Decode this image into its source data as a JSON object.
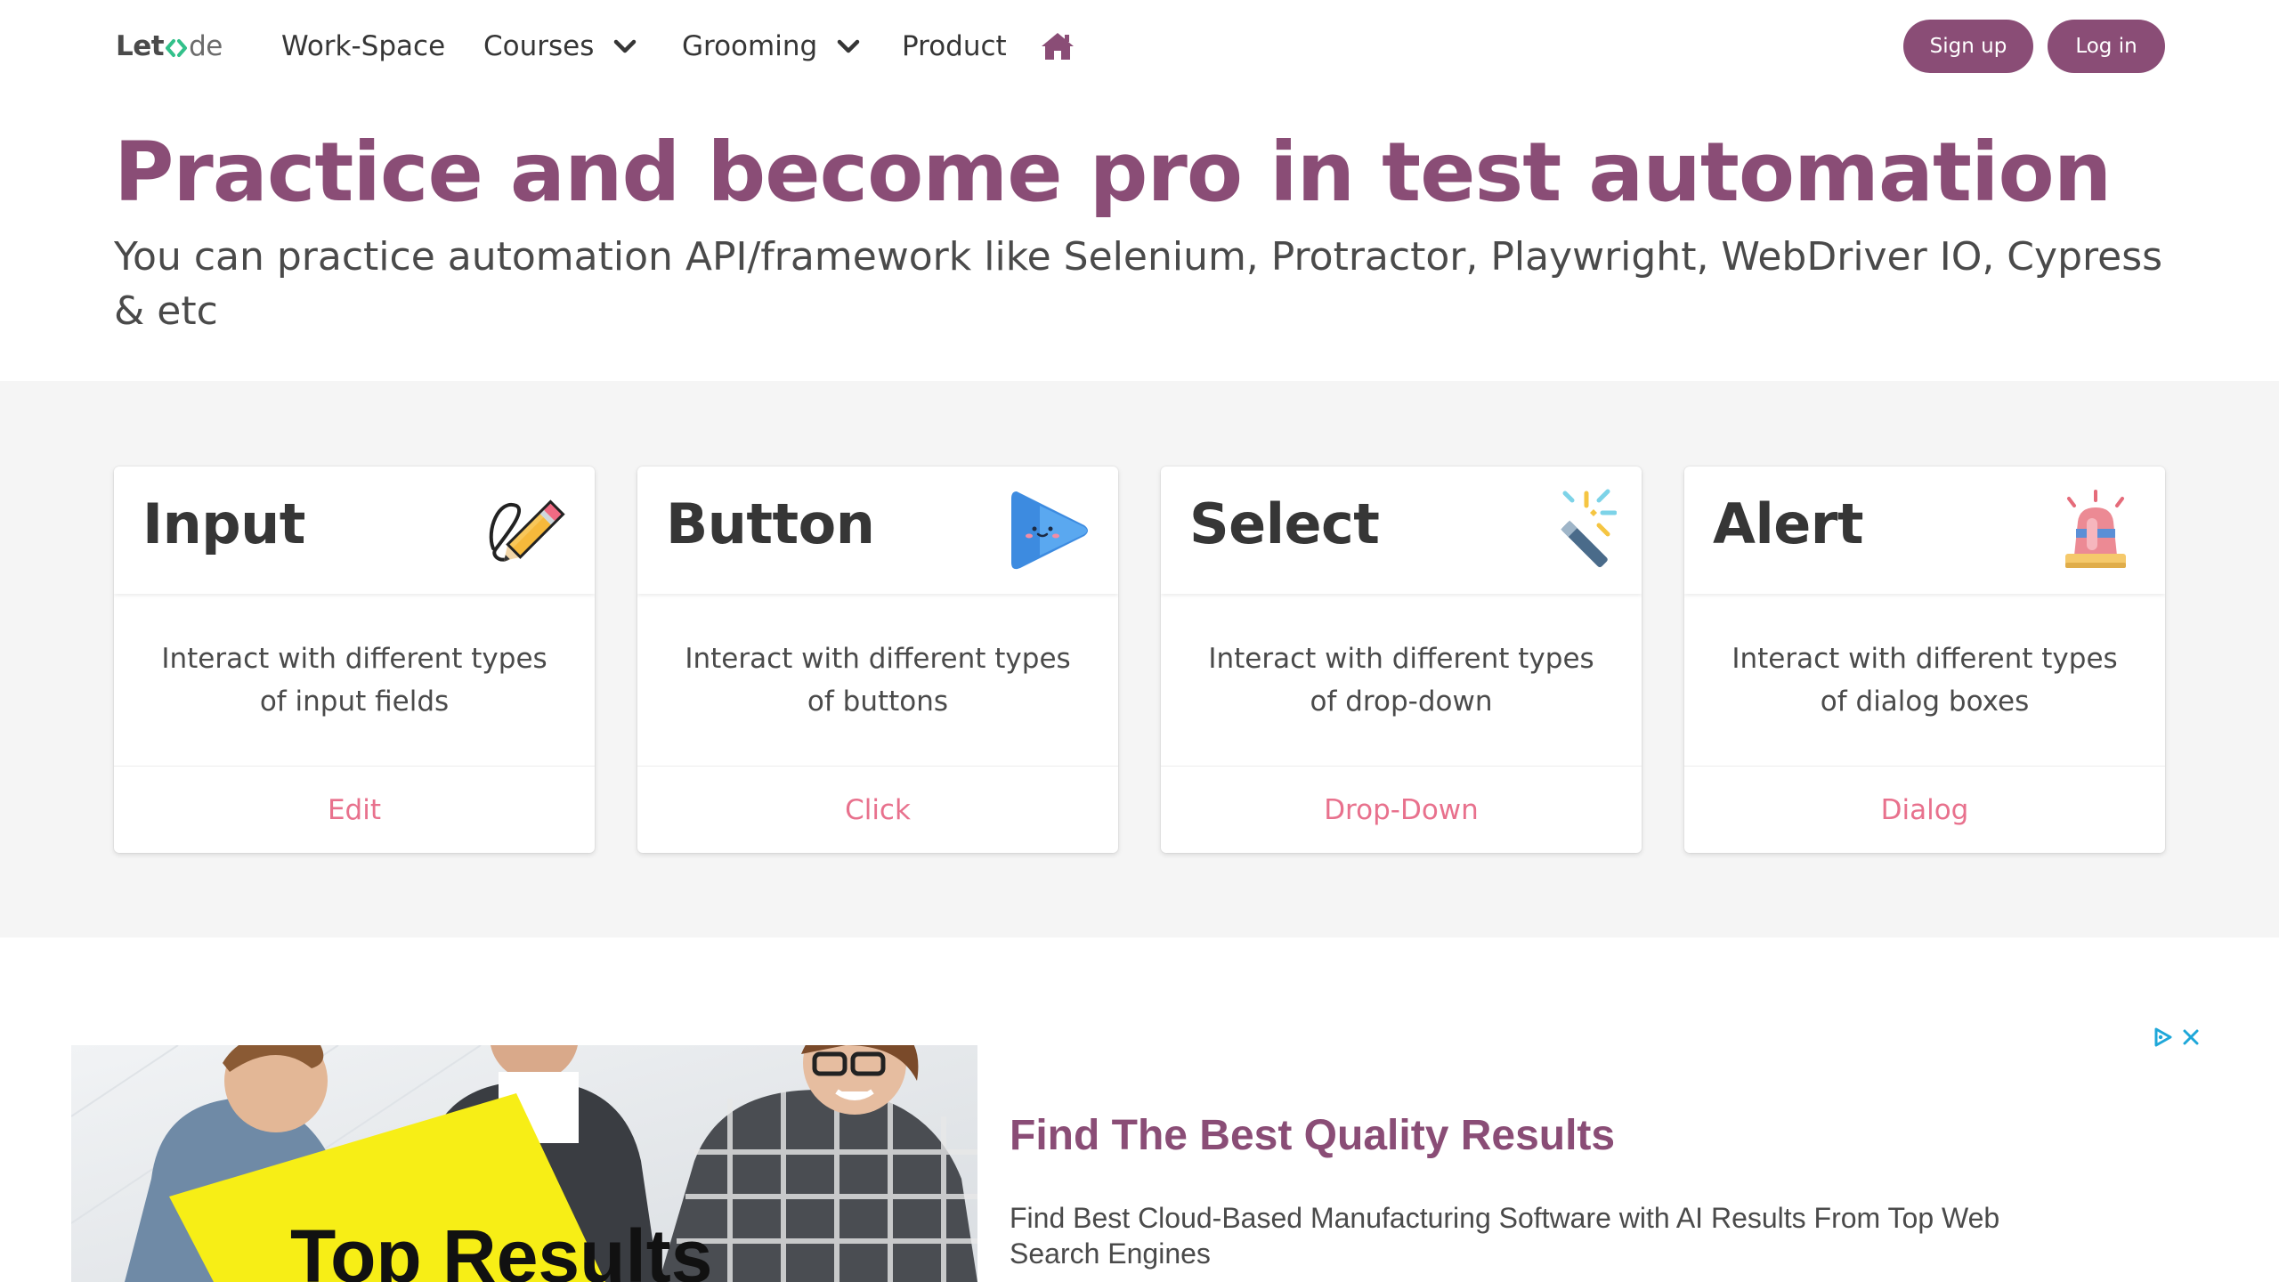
{
  "nav": {
    "brand_prefix": "Let",
    "brand_suffix": "de",
    "items": [
      {
        "label": "Work-Space",
        "has_dropdown": false
      },
      {
        "label": "Courses",
        "has_dropdown": true
      },
      {
        "label": "Grooming",
        "has_dropdown": true
      },
      {
        "label": "Product",
        "has_dropdown": false
      }
    ],
    "home_icon": "home-icon",
    "signup_label": "Sign up",
    "login_label": "Log in"
  },
  "hero": {
    "title": "Practice and become pro in test automation",
    "subtitle": "You can practice automation API/framework like Selenium, Protractor, Playwright, WebDriver IO, Cypress & etc"
  },
  "cards": [
    {
      "title": "Input",
      "icon": "pencil-icon",
      "description": "Interact with different types of input fields",
      "action": "Edit"
    },
    {
      "title": "Button",
      "icon": "play-button-icon",
      "description": "Interact with different types of buttons",
      "action": "Click"
    },
    {
      "title": "Select",
      "icon": "magic-wand-icon",
      "description": "Interact with different types of drop-down",
      "action": "Drop-Down"
    },
    {
      "title": "Alert",
      "icon": "siren-icon",
      "description": "Interact with different types of dialog boxes",
      "action": "Dialog"
    }
  ],
  "ad": {
    "image_text": "Top Results",
    "headline": "Find The Best Quality Results",
    "description": "Find Best Cloud-Based Manufacturing Software with AI Results From Top Web Search Engines",
    "adchoices_icon": "adchoices-icon",
    "close_icon": "close-icon"
  },
  "colors": {
    "brand_purple": "#8a4d76",
    "action_pink": "#e8718d",
    "section_gray": "#f5f5f5",
    "logo_green": "#32c08a"
  }
}
